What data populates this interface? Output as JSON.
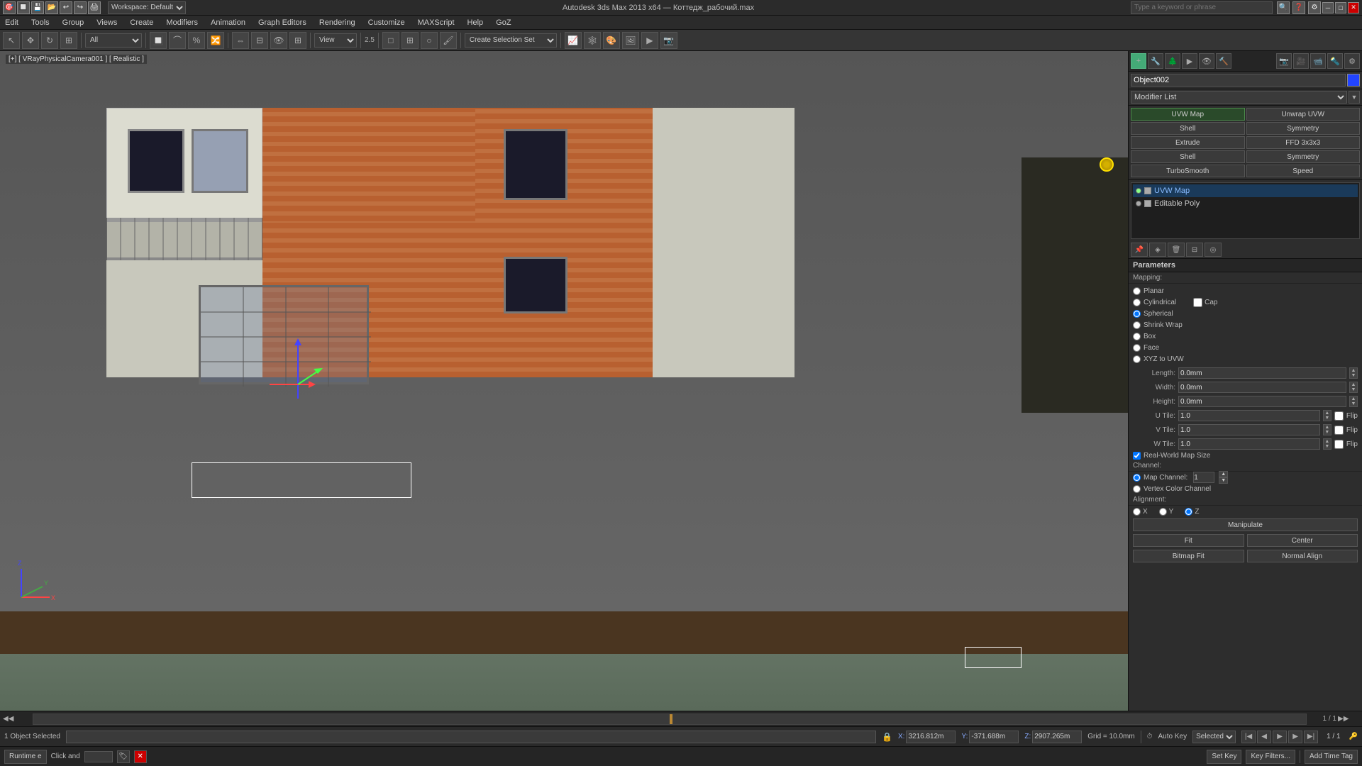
{
  "app": {
    "title": "Autodesk 3ds Max 2013 x64 — Коттедж_рабочий.max",
    "workspace": "Workspace: Default"
  },
  "topbar": {
    "icons": [
      "🔲",
      "💾",
      "📂",
      "↩",
      "↪",
      "🖨",
      "✂"
    ]
  },
  "menu": {
    "items": [
      "Edit",
      "Tools",
      "Group",
      "Views",
      "Create",
      "Modifiers",
      "Animation",
      "Graph Editors",
      "Rendering",
      "Customize",
      "MAXScript",
      "Help",
      "GoZ"
    ]
  },
  "viewport": {
    "label": "[+] [ VRayPhysicalCamera001 ] [ Realistic ]",
    "frame_counter": "1 / 1"
  },
  "right_panel": {
    "object_name": "Object002",
    "modifier_list_label": "Modifier List",
    "modifiers": [
      {
        "name": "UVW Map",
        "col": 1
      },
      {
        "name": "Unwrap UVW",
        "col": 2
      },
      {
        "name": "Shell",
        "col": 1
      },
      {
        "name": "Symmetry",
        "col": 2
      },
      {
        "name": "Extrude",
        "col": 1
      },
      {
        "name": "FFD 3x3x3",
        "col": 2
      },
      {
        "name": "Shell",
        "col": 1
      },
      {
        "name": "Symmetry",
        "col": 2
      },
      {
        "name": "TurboSmooth",
        "col": 1
      },
      {
        "name": "Speed",
        "col": 2
      }
    ],
    "stack_items": [
      {
        "name": "UVW Map",
        "selected": true
      },
      {
        "name": "Editable Poly",
        "selected": false
      }
    ],
    "parameters": {
      "title": "Parameters",
      "mapping_label": "Mapping:",
      "mapping_options": [
        "Planar",
        "Cylindrical",
        "Cap",
        "Spherical",
        "Shrink Wrap",
        "Box",
        "Face",
        "XYZ to UVW"
      ],
      "active_mapping": "Spherical",
      "length_label": "Length:",
      "length_value": "0.0mm",
      "width_label": "Width:",
      "width_value": "0.0mm",
      "height_label": "Height:",
      "height_value": "0.0mm",
      "u_tile_label": "U Tile:",
      "u_tile_value": "1.0",
      "v_tile_label": "V Tile:",
      "v_tile_value": "1.0",
      "w_tile_label": "W Tile:",
      "w_tile_value": "1.0",
      "flip_label": "Flip",
      "realworld_label": "Real-World Map Size",
      "channel_label": "Channel:",
      "map_channel_label": "Map Channel:",
      "map_channel_value": "1",
      "vertex_color_label": "Vertex Color Channel",
      "alignment_label": "Alignment:",
      "align_x": "X",
      "align_y": "Y",
      "align_z": "Z",
      "manipulate_label": "Manipulate",
      "fit_label": "Fit",
      "center_label": "Center",
      "bitmap_fit_label": "Bitmap Fit",
      "normal_align_label": "Normal Align"
    }
  },
  "status": {
    "selected_label": "1 Object Selected",
    "click_label": "Click and",
    "runtime_label": "Runtime e",
    "x_label": "X:",
    "x_value": "3216.812m",
    "y_label": "Y:",
    "y_value": "-371.688m",
    "z_label": "Z:",
    "z_value": "2907.265m",
    "grid_label": "Grid = 10.0mm",
    "auto_key_label": "Auto Key",
    "selected_badge": "Selected",
    "time_tag_label": "Add Time Tag",
    "key_filters_label": "Key Filters...",
    "frame": "1 / 1"
  },
  "search": {
    "placeholder": "Type a keyword or phrase"
  }
}
